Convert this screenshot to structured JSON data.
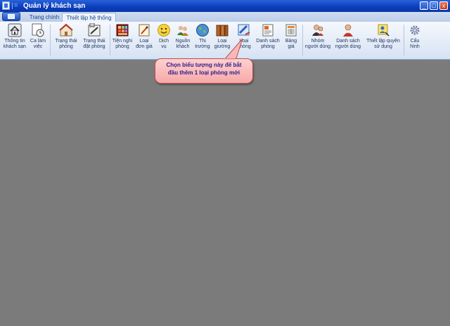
{
  "window": {
    "title": "Quản lý khách sạn",
    "qat_menu_glyph": "=",
    "controls": {
      "minimize": "_",
      "maximize": "□",
      "close": "x"
    }
  },
  "tabs": [
    {
      "label": "Trang chính",
      "selected": false
    },
    {
      "label": "Thiết lập hệ thống",
      "selected": true
    }
  ],
  "ribbon": {
    "buttons": [
      {
        "name": "ribbon-btn-hotel-info",
        "line1": "Thông tin",
        "line2": "khách sạn",
        "icon": "house-icon"
      },
      {
        "name": "ribbon-btn-shift",
        "line1": "Ca làm",
        "line2": "việc",
        "icon": "clock-icon"
      },
      {
        "name": "ribbon-btn-room-status",
        "line1": "Trạng thái",
        "line2": "phòng",
        "icon": "room-house-icon"
      },
      {
        "name": "ribbon-btn-booking-status",
        "line1": "Trạng thái",
        "line2": "đặt phòng",
        "icon": "booking-board-icon"
      },
      {
        "name": "ribbon-btn-room-amenities",
        "line1": "Tiện nghi",
        "line2": "phòng",
        "icon": "amenities-icon"
      },
      {
        "name": "ribbon-btn-price-type",
        "line1": "Loại",
        "line2": "đơn giá",
        "icon": "price-tag-icon"
      },
      {
        "name": "ribbon-btn-service",
        "line1": "Dịch",
        "line2": "vụ",
        "icon": "smiley-icon"
      },
      {
        "name": "ribbon-btn-guest-source",
        "line1": "Nguồn",
        "line2": "khách",
        "icon": "guests-icon"
      },
      {
        "name": "ribbon-btn-market",
        "line1": "Thị",
        "line2": "trường",
        "icon": "globe-icon"
      },
      {
        "name": "ribbon-btn-bed-type",
        "line1": "Loại",
        "line2": "giường",
        "icon": "bed-icon"
      },
      {
        "name": "ribbon-btn-room-type",
        "line1": "Loại",
        "line2": "phòng",
        "icon": "room-type-icon"
      },
      {
        "name": "ribbon-btn-room-list",
        "line1": "Danh sách",
        "line2": "phòng",
        "icon": "room-list-icon"
      },
      {
        "name": "ribbon-btn-price-table",
        "line1": "Bảng",
        "line2": "giá",
        "icon": "price-table-icon"
      },
      {
        "name": "ribbon-btn-user-group",
        "line1": "Nhóm",
        "line2": "người dùng",
        "icon": "user-group-icon"
      },
      {
        "name": "ribbon-btn-user-list",
        "line1": "Danh sách",
        "line2": "người dùng",
        "icon": "user-icon"
      },
      {
        "name": "ribbon-btn-permissions",
        "line1": "Thiết lập quyền",
        "line2": "sử dụng",
        "icon": "key-user-icon"
      },
      {
        "name": "ribbon-btn-config",
        "line1": "Cấu",
        "line2": "hình",
        "icon": "settings-gear-icon"
      }
    ]
  },
  "callout": {
    "line1": "Chọn biểu tượng này để bắt",
    "line2": "đầu thêm 1 loại phòng mới"
  },
  "colors": {
    "titlebar": "#0b3fbf",
    "workspace": "#7b7b7b",
    "callout_fill": "#f7a8a8",
    "callout_text": "#2d1b8a"
  }
}
